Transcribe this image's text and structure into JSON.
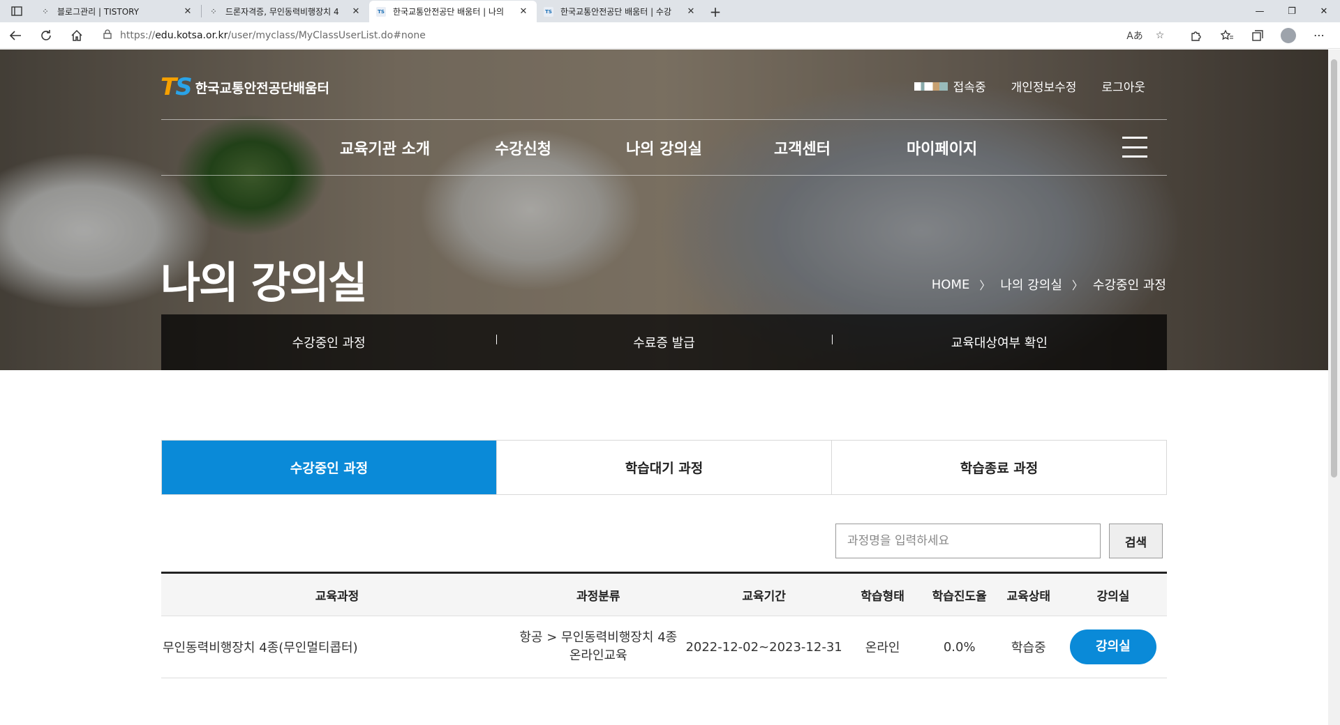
{
  "browser": {
    "tabs": [
      {
        "title": "블로그관리 | TISTORY",
        "favicon": "tistory-icon"
      },
      {
        "title": "드론자격증, 무인동력비행장치 4",
        "favicon": "tistory-icon"
      },
      {
        "title": "한국교통안전공단 배움터 | 나의",
        "favicon": "ts-icon"
      },
      {
        "title": "한국교통안전공단 배움터 | 수강",
        "favicon": "ts-icon"
      }
    ],
    "url_prefix": "https://",
    "url_host": "edu.kotsa.or.kr",
    "url_path": "/user/myclass/MyClassUserList.do#none"
  },
  "site": {
    "logo_mark_t": "T",
    "logo_mark_s": "S",
    "logo_name": "한국교통안전공단배움터",
    "util": {
      "status": "접속중",
      "profile": "개인정보수정",
      "logout": "로그아웃"
    },
    "gnb": [
      "교육기관 소개",
      "수강신청",
      "나의 강의실",
      "고객센터",
      "마이페이지"
    ],
    "page_title": "나의 강의실",
    "breadcrumb": [
      "HOME",
      "나의 강의실",
      "수강중인 과정"
    ],
    "subnav": [
      "수강중인 과정",
      "수료증 발급",
      "교육대상여부 확인"
    ]
  },
  "content": {
    "tabs": [
      "수강중인 과정",
      "학습대기 과정",
      "학습종료 과정"
    ],
    "search": {
      "placeholder": "과정명을 입력하세요",
      "button": "검색"
    },
    "table": {
      "headers": [
        "교육과정",
        "과정분류",
        "교육기간",
        "학습형태",
        "학습진도율",
        "교육상태",
        "강의실"
      ],
      "rows": [
        {
          "course": "무인동력비행장치 4종(무인멀티콥터)",
          "category_line1": "항공 > 무인동력비행장치 4종",
          "category_line2": "온라인교육",
          "period": "2022-12-02~2023-12-31",
          "type": "온라인",
          "progress": "0.0%",
          "status": "학습중",
          "button": "강의실"
        }
      ]
    }
  },
  "colors": {
    "accent": "#0a8ad8",
    "logo_t": "#f5a000",
    "logo_s": "#2aa3e8"
  }
}
